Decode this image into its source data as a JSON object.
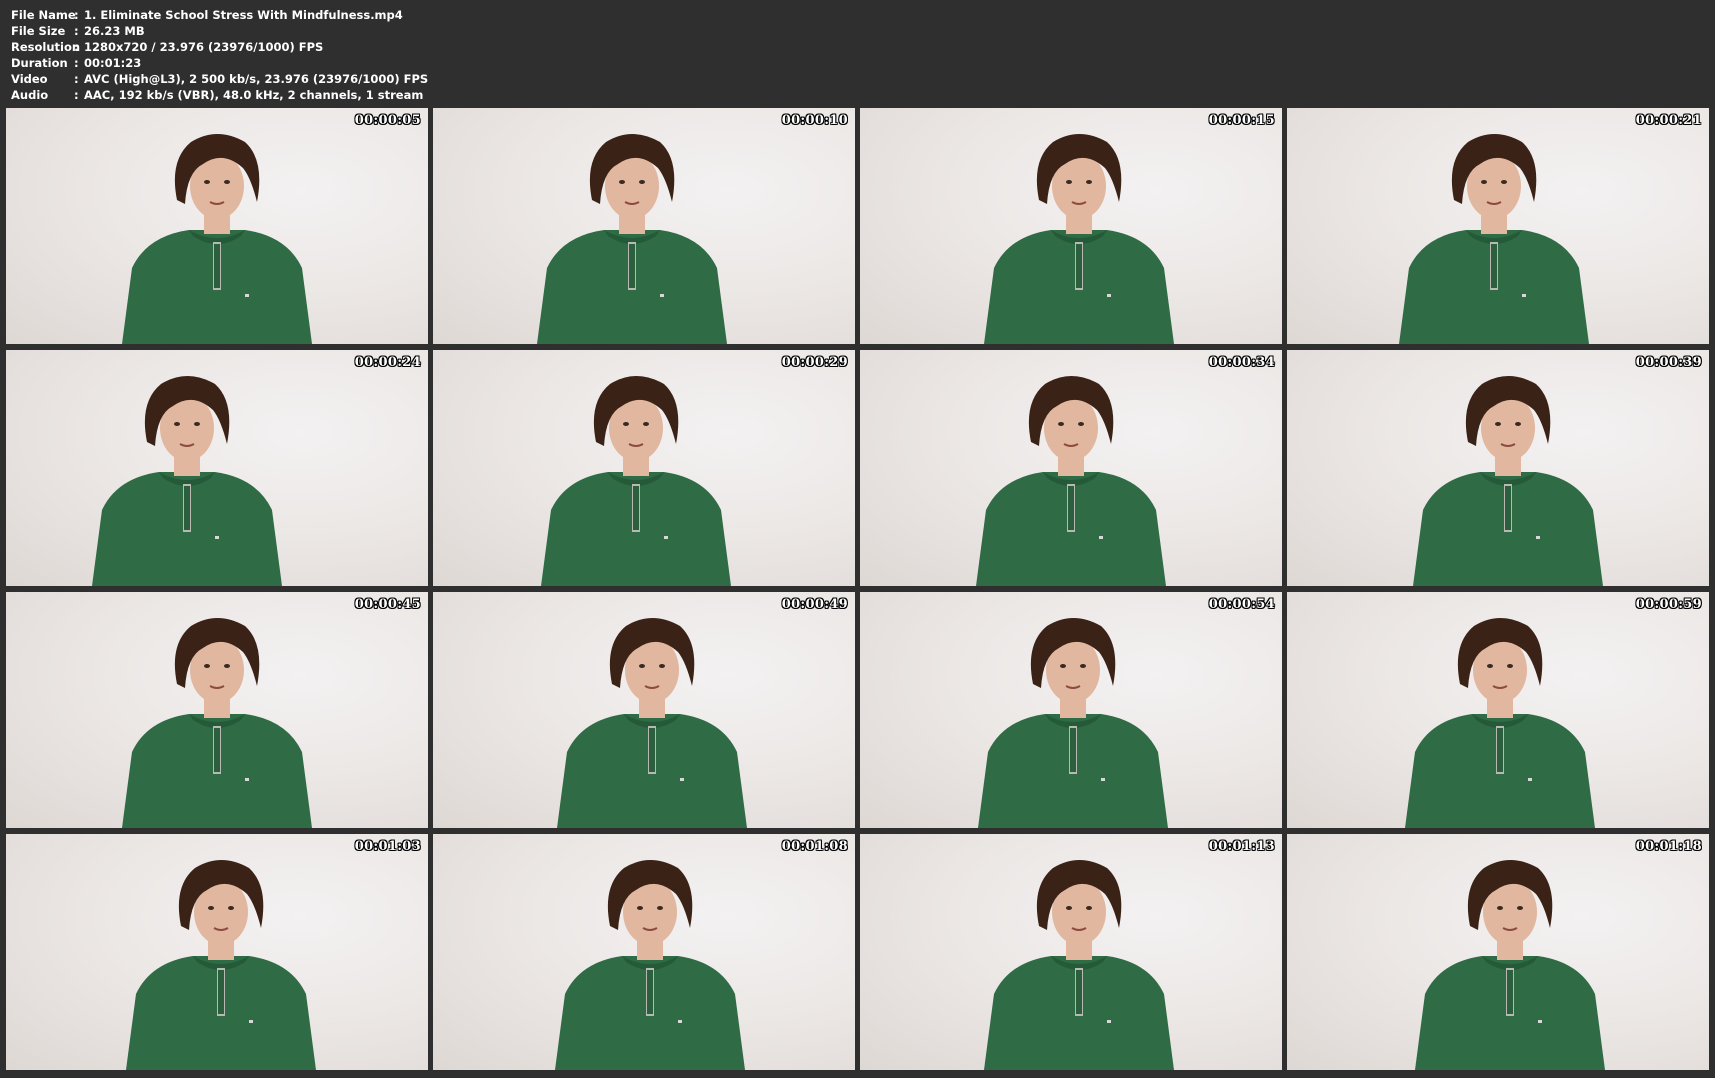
{
  "info": [
    {
      "key": "File Name",
      "value": "1. Eliminate School Stress With Mindfulness.mp4"
    },
    {
      "key": "File Size",
      "value": "26.23 MB"
    },
    {
      "key": "Resolution",
      "value": "1280x720 / 23.976 (23976/1000) FPS"
    },
    {
      "key": "Duration",
      "value": "00:01:23"
    },
    {
      "key": "Video",
      "value": "AVC (High@L3), 2 500 kb/s, 23.976 (23976/1000) FPS"
    },
    {
      "key": "Audio",
      "value": "AAC, 192 kb/s (VBR), 48.0 kHz, 2 channels, 1 stream"
    }
  ],
  "separator": ":",
  "frames": [
    {
      "timestamp": "00:00:05"
    },
    {
      "timestamp": "00:00:10"
    },
    {
      "timestamp": "00:00:15"
    },
    {
      "timestamp": "00:00:21"
    },
    {
      "timestamp": "00:00:24"
    },
    {
      "timestamp": "00:00:29"
    },
    {
      "timestamp": "00:00:34"
    },
    {
      "timestamp": "00:00:39"
    },
    {
      "timestamp": "00:00:45"
    },
    {
      "timestamp": "00:00:49"
    },
    {
      "timestamp": "00:00:54"
    },
    {
      "timestamp": "00:00:59"
    },
    {
      "timestamp": "00:01:03"
    },
    {
      "timestamp": "00:01:08"
    },
    {
      "timestamp": "00:01:13"
    },
    {
      "timestamp": "00:01:18"
    }
  ],
  "colors": {
    "background": "#2f2f2f",
    "shirt": "#2f6b45",
    "hair": "#3a2216",
    "skin": "#e2b79f"
  }
}
